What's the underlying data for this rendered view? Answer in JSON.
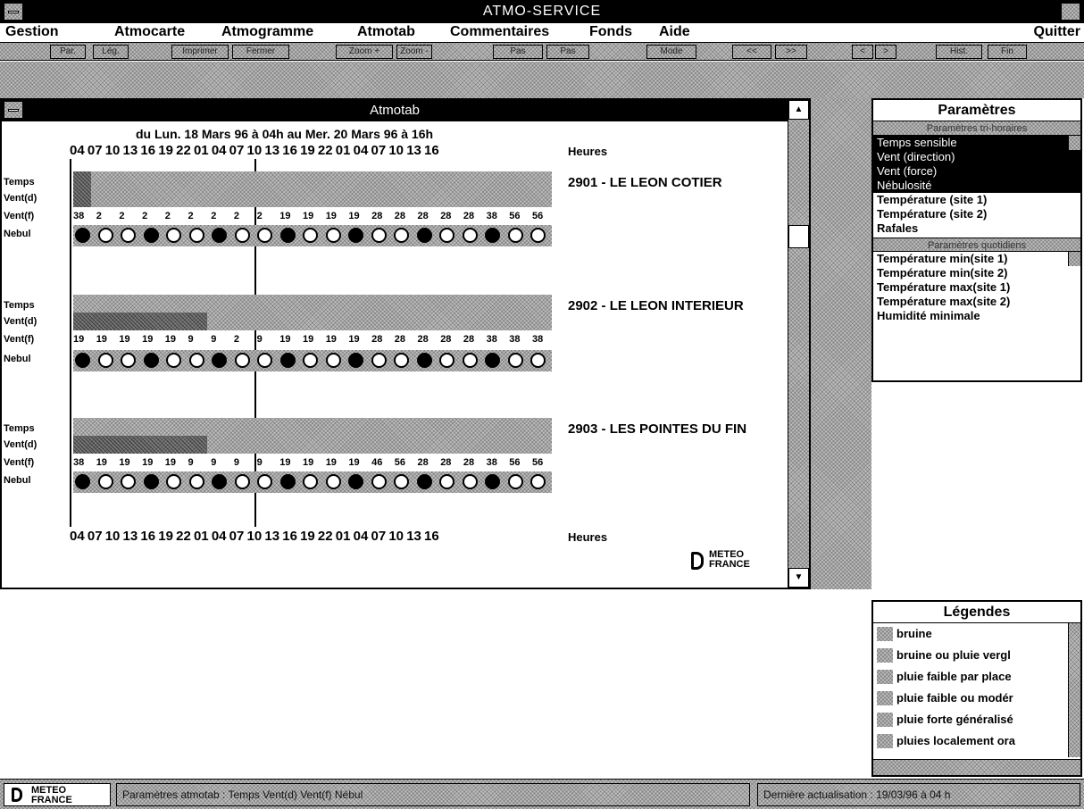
{
  "app": {
    "title": "ATMO-SERVICE"
  },
  "menu": {
    "items": [
      "Gestion",
      "Atmocarte",
      "Atmogramme",
      "Atmotab",
      "Commentaires",
      "Fonds",
      "Aide"
    ],
    "quit": "Quitter"
  },
  "toolbar": {
    "buttons": [
      "Par.",
      "Lég.",
      "Imprimer",
      "Fermer",
      "Zoom +",
      "Zoom -",
      "Pas",
      "Pas",
      "Mode",
      "<<",
      ">>",
      "<",
      ">",
      "Hist.",
      "Fin"
    ]
  },
  "atmotab": {
    "title": "Atmotab",
    "period": "du Lun. 18 Mars 96 à 04h au Mer. 20 Mars 96 à 16h",
    "hours": "04 07 10 13 16 19 22 01 04 07 10 13 16 19 22 01 04 07 10 13 16",
    "hours_label": "Heures",
    "row_labels": [
      "Temps",
      "Vent(d)",
      "Vent(f)",
      "Nebul"
    ],
    "sites": [
      {
        "name": "2901 - LE LEON COTIER",
        "vent_f": [
          "38",
          "2",
          "2",
          "2",
          "2",
          "2",
          "2",
          "2",
          "2",
          "19",
          "19",
          "19",
          "19",
          "28",
          "28",
          "28",
          "28",
          "28",
          "38",
          "56",
          "56"
        ]
      },
      {
        "name": "2902 - LE LEON INTERIEUR",
        "vent_f": [
          "19",
          "19",
          "19",
          "19",
          "19",
          "9",
          "9",
          "2",
          "9",
          "19",
          "19",
          "19",
          "19",
          "28",
          "28",
          "28",
          "28",
          "28",
          "38",
          "38",
          "38"
        ]
      },
      {
        "name": "2903 - LES POINTES DU FIN",
        "vent_f": [
          "38",
          "19",
          "19",
          "19",
          "19",
          "9",
          "9",
          "9",
          "9",
          "19",
          "19",
          "19",
          "19",
          "46",
          "56",
          "28",
          "28",
          "28",
          "38",
          "56",
          "56"
        ]
      }
    ],
    "logo": [
      "METEO",
      "FRANCE"
    ]
  },
  "parametres": {
    "title": "Paramètres",
    "trihoraires_label": "Paramètres tri-horaires",
    "trihoraires": [
      "Temps sensible",
      "Vent (direction)",
      "Vent (force)",
      "Nébulosité",
      "Température (site 1)",
      "Température (site 2)",
      "Rafales"
    ],
    "selected_count": 4,
    "quotidiens_label": "Paramètres quotidiens",
    "quotidiens": [
      "Température min(site 1)",
      "Température min(site 2)",
      "Température max(site 1)",
      "Température max(site 2)",
      "Humidité minimale"
    ]
  },
  "legendes": {
    "title": "Légendes",
    "items": [
      "bruine",
      "bruine ou pluie vergl",
      "pluie faible par place",
      "pluie faible ou modér",
      "pluie forte généralisé",
      "pluies localement ora"
    ]
  },
  "status": {
    "left": "Paramètres atmotab : Temps Vent(d) Vent(f) Nébul",
    "right": "Dernière actualisation : 19/03/96 à 04 h",
    "logo": [
      "METEO",
      "FRANCE"
    ]
  }
}
